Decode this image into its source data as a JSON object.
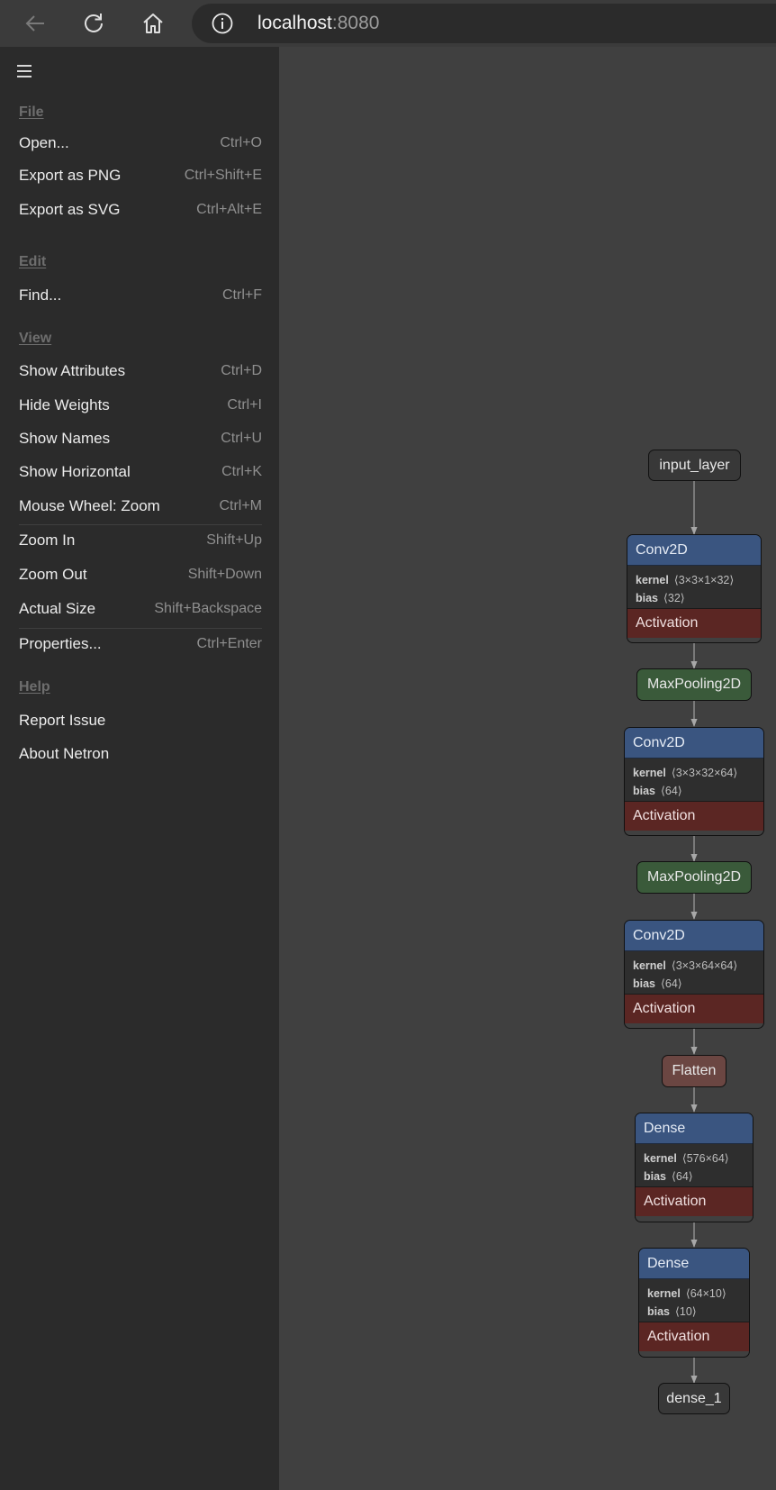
{
  "browser": {
    "url_host": "localhost",
    "url_port": ":8080"
  },
  "menu": {
    "groups": [
      {
        "label": "File",
        "items": [
          {
            "label": "Open...",
            "shortcut": "Ctrl+O"
          },
          {
            "label": "Export as PNG",
            "shortcut": "Ctrl+Shift+E"
          },
          {
            "label": "Export as SVG",
            "shortcut": "Ctrl+Alt+E"
          }
        ]
      },
      {
        "label": "Edit",
        "items": [
          {
            "label": "Find...",
            "shortcut": "Ctrl+F"
          }
        ]
      },
      {
        "label": "View",
        "items": [
          {
            "label": "Show Attributes",
            "shortcut": "Ctrl+D"
          },
          {
            "label": "Hide Weights",
            "shortcut": "Ctrl+I"
          },
          {
            "label": "Show Names",
            "shortcut": "Ctrl+U"
          },
          {
            "label": "Show Horizontal",
            "shortcut": "Ctrl+K"
          },
          {
            "label": "Mouse Wheel: Zoom",
            "shortcut": "Ctrl+M"
          },
          {
            "label": "Zoom In",
            "shortcut": "Shift+Up"
          },
          {
            "label": "Zoom Out",
            "shortcut": "Shift+Down"
          },
          {
            "label": "Actual Size",
            "shortcut": "Shift+Backspace"
          },
          {
            "label": "Properties...",
            "shortcut": "Ctrl+Enter"
          }
        ]
      },
      {
        "label": "Help",
        "items": [
          {
            "label": "Report Issue",
            "shortcut": ""
          },
          {
            "label": "About Netron",
            "shortcut": ""
          }
        ]
      }
    ]
  },
  "graph": {
    "input_node": "input_layer",
    "output_node": "dense_1",
    "layers": [
      {
        "type": "Conv2D",
        "kernel": "⟨3×3×1×32⟩",
        "bias": "⟨32⟩",
        "activation": "Activation"
      },
      {
        "type": "MaxPooling2D"
      },
      {
        "type": "Conv2D",
        "kernel": "⟨3×3×32×64⟩",
        "bias": "⟨64⟩",
        "activation": "Activation"
      },
      {
        "type": "MaxPooling2D"
      },
      {
        "type": "Conv2D",
        "kernel": "⟨3×3×64×64⟩",
        "bias": "⟨64⟩",
        "activation": "Activation"
      },
      {
        "type": "Flatten"
      },
      {
        "type": "Dense",
        "kernel": "⟨576×64⟩",
        "bias": "⟨64⟩",
        "activation": "Activation"
      },
      {
        "type": "Dense",
        "kernel": "⟨64×10⟩",
        "bias": "⟨10⟩",
        "activation": "Activation"
      }
    ],
    "attr_labels": {
      "kernel": "kernel",
      "bias": "bias"
    }
  }
}
